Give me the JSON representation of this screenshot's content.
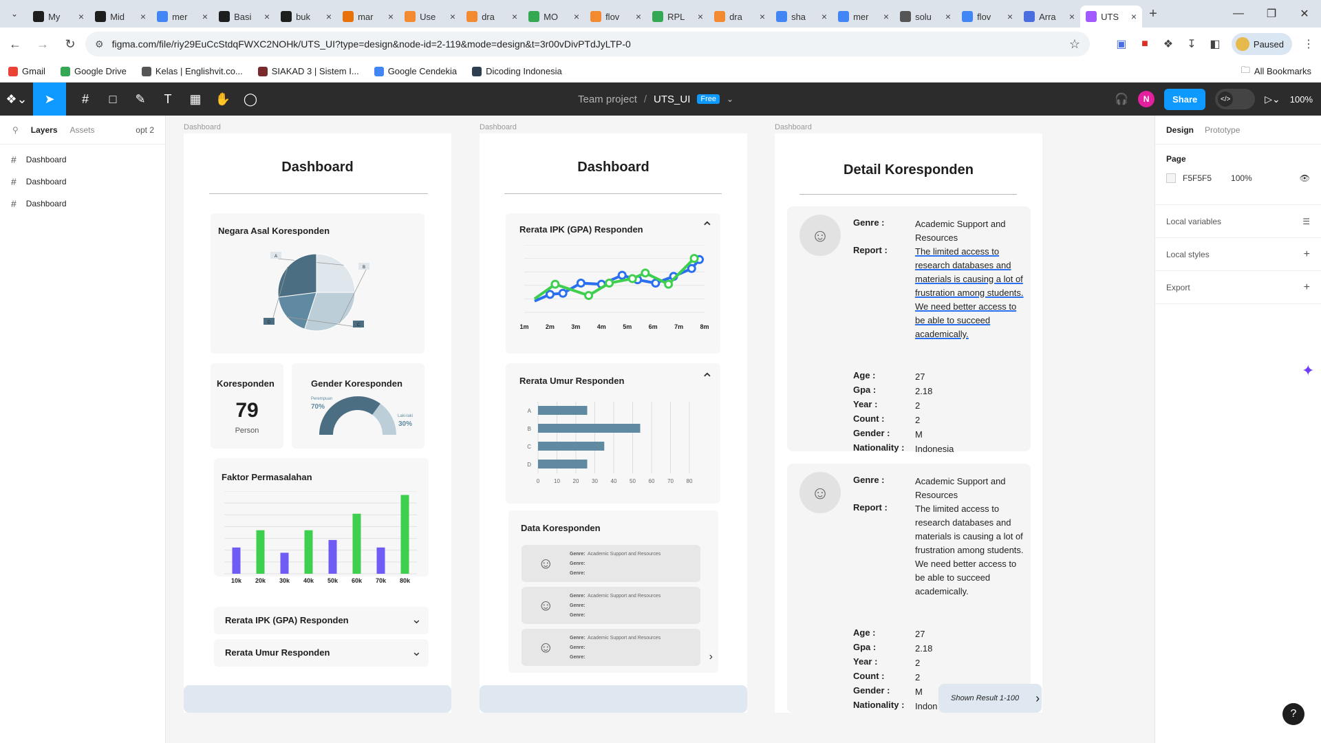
{
  "browser": {
    "tabs": [
      {
        "title": "My",
        "color": "#1e1e1e",
        "icon": "miro-icon"
      },
      {
        "title": "Mid",
        "color": "#1e1e1e",
        "icon": "github-icon"
      },
      {
        "title": "mer",
        "color": "#4285f4",
        "icon": "google-icon"
      },
      {
        "title": "Basi",
        "color": "#1e1e1e",
        "icon": "github-icon"
      },
      {
        "title": "buk",
        "color": "#1e1e1e",
        "icon": "github-icon"
      },
      {
        "title": "mar",
        "color": "#e8710a",
        "icon": "app-icon"
      },
      {
        "title": "Use",
        "color": "#f28b30",
        "icon": "drawio-icon"
      },
      {
        "title": "dra",
        "color": "#f28b30",
        "icon": "drawio-icon"
      },
      {
        "title": "MO",
        "color": "#34a853",
        "icon": "drive-icon"
      },
      {
        "title": "flov",
        "color": "#f28b30",
        "icon": "drawio-icon"
      },
      {
        "title": "RPL",
        "color": "#34a853",
        "icon": "drive-icon"
      },
      {
        "title": "dra",
        "color": "#f28b30",
        "icon": "drawio-icon"
      },
      {
        "title": "sha",
        "color": "#4285f4",
        "icon": "google-icon"
      },
      {
        "title": "mer",
        "color": "#4285f4",
        "icon": "google-icon"
      },
      {
        "title": "solu",
        "color": "#555555",
        "icon": "app-icon"
      },
      {
        "title": "flov",
        "color": "#4285f4",
        "icon": "google-icon"
      },
      {
        "title": "Arra",
        "color": "#4a6ee0",
        "icon": "docs-icon"
      },
      {
        "title": "UTS",
        "color": "#a259ff",
        "icon": "figma-icon"
      }
    ],
    "url": "figma.com/file/riy29EuCcStdqFWXC2NOHk/UTS_UI?type=design&node-id=2-119&mode=design&t=3r00vDivPTdJyLTP-0",
    "profile_label": "Paused",
    "bookmarks": [
      {
        "label": "Gmail",
        "color": "#ea4335"
      },
      {
        "label": "Google Drive",
        "color": "#34a853"
      },
      {
        "label": "Kelas | Englishvit.co...",
        "color": "#555555"
      },
      {
        "label": "SIAKAD 3 | Sistem I...",
        "color": "#7a2a2a"
      },
      {
        "label": "Google Cendekia",
        "color": "#4285f4"
      },
      {
        "label": "Dicoding Indonesia",
        "color": "#2d3e50"
      }
    ],
    "all_bookmarks": "All Bookmarks"
  },
  "figma": {
    "project": "Team project",
    "separator": "/",
    "file": "UTS_UI",
    "plan": "Free",
    "avatar": "N",
    "share": "Share",
    "zoom": "100%",
    "left_tabs": {
      "layers": "Layers",
      "assets": "Assets",
      "page": "opt 2"
    },
    "layers": [
      "Dashboard",
      "Dashboard",
      "Dashboard"
    ],
    "right_tabs": {
      "design": "Design",
      "prototype": "Prototype"
    },
    "page_label": "Page",
    "page_color": "F5F5F5",
    "page_opacity": "100%",
    "sections": [
      "Local variables",
      "Local styles",
      "Export"
    ]
  },
  "canvas": {
    "frame_labels": [
      "Dashboard",
      "Dashboard",
      "Dashboard"
    ],
    "frame1": {
      "title": "Dashboard",
      "pie_title": "Negara Asal Koresponden",
      "pie_labels": [
        "A",
        "B",
        "C",
        "D"
      ],
      "koresponden_title": "Koresponden",
      "koresponden_value": "79",
      "koresponden_unit": "Person",
      "gender_title": "Gender Koresponden",
      "gender_left_label": "Perempuan",
      "gender_left_value": "70%",
      "gender_right_label": "Laki-laki",
      "gender_right_value": "30%",
      "faktor_title": "Faktor Permasalahan",
      "acc1": "Rerata IPK (GPA) Responden",
      "acc2": "Rerata Umur Responden"
    },
    "frame2": {
      "title": "Dashboard",
      "ipk_title": "Rerata IPK (GPA) Responden",
      "umur_title": "Rerata Umur Responden",
      "data_title": "Data Koresponden",
      "mini_rows": [
        {
          "genre_k": "Genre:",
          "genre_v": "Academic Support and Resources",
          "k2": "Genre:",
          "k3": "Genre:"
        },
        {
          "genre_k": "Genre:",
          "genre_v": "Academic Support and Resources",
          "k2": "Genre:",
          "k3": "Genre:"
        },
        {
          "genre_k": "Genre:",
          "genre_v": "Academic Support and Resources",
          "k2": "Genre:",
          "k3": "Genre:"
        }
      ]
    },
    "frame3": {
      "title": "Detail Koresponden",
      "records": [
        {
          "genre_k": "Genre :",
          "genre_v": "Academic Support and Resources",
          "report_k": "Report :",
          "report_v": "The limited access to research databases and materials is causing a lot of frustration among students. We need better access to be able to succeed academically.",
          "age_k": "Age :",
          "age_v": "27",
          "gpa_k": "Gpa :",
          "gpa_v": "2.18",
          "year_k": "Year :",
          "year_v": "2",
          "count_k": "Count :",
          "count_v": "2",
          "gender_k": "Gender :",
          "gender_v": "M",
          "nat_k": "Nationality :",
          "nat_v": "Indonesia"
        },
        {
          "genre_k": "Genre :",
          "genre_v": "Academic Support and Resources",
          "report_k": "Report :",
          "report_v": "The limited access to research databases and materials is causing a lot of frustration among students. We need better access to be able to succeed academically.",
          "age_k": "Age :",
          "age_v": "27",
          "gpa_k": "Gpa :",
          "gpa_v": "2.18",
          "year_k": "Year :",
          "year_v": "2",
          "count_k": "Count :",
          "count_v": "2",
          "gender_k": "Gender :",
          "gender_v": "M",
          "nat_k": "Nationality :",
          "nat_v": "Indon"
        }
      ],
      "shown": "Shown Result 1-100"
    }
  },
  "chart_data": [
    {
      "type": "pie",
      "title": "Negara Asal Koresponden",
      "categories": [
        "A",
        "B",
        "C",
        "D"
      ],
      "values": [
        25,
        30,
        18,
        27
      ],
      "colors": [
        "#dfe6ec",
        "#bccfd9",
        "#5f8aa1",
        "#4c6e82"
      ]
    },
    {
      "type": "bar",
      "title": "Faktor Permasalahan",
      "categories": [
        "10k",
        "20k",
        "30k",
        "40k",
        "50k",
        "60k",
        "70k",
        "80k"
      ],
      "values": [
        35,
        58,
        28,
        58,
        45,
        80,
        35,
        105
      ],
      "colors": [
        "#6f5cf5",
        "#3ecf4f",
        "#6f5cf5",
        "#3ecf4f",
        "#6f5cf5",
        "#3ecf4f",
        "#6f5cf5",
        "#3ecf4f"
      ],
      "ylim": [
        0,
        110
      ]
    },
    {
      "type": "line",
      "title": "Rerata IPK (GPA) Responden",
      "categories": [
        "1m",
        "2m",
        "3m",
        "4m",
        "5m",
        "6m",
        "7m",
        "8m"
      ],
      "series": [
        {
          "color": "#2a6ff0",
          "x": [
            0.4,
            1,
            1.5,
            2.2,
            3,
            3.8,
            4.4,
            5.1,
            5.8,
            6.5,
            6.8
          ],
          "values": [
            1.0,
            1.6,
            1.7,
            2.6,
            2.5,
            3.3,
            2.9,
            2.6,
            3.2,
            3.9,
            4.7
          ]
        },
        {
          "color": "#3ecf4f",
          "x": [
            0.4,
            1.2,
            2.5,
            3.3,
            4.2,
            4.7,
            5.6,
            6.6
          ],
          "values": [
            1.2,
            2.5,
            1.5,
            2.6,
            3.0,
            3.5,
            2.5,
            4.8
          ]
        }
      ],
      "ylim": [
        0,
        6
      ]
    },
    {
      "type": "bar",
      "orientation": "horizontal",
      "title": "Rerata Umur Responden",
      "categories": [
        "A",
        "B",
        "C",
        "D"
      ],
      "values": [
        26,
        54,
        35,
        26
      ],
      "color": "#5f8aa1",
      "xticks": [
        0,
        10,
        20,
        30,
        40,
        50,
        60,
        70,
        80
      ],
      "xlim": [
        0,
        80
      ]
    },
    {
      "type": "gauge",
      "title": "Gender Koresponden",
      "categories": [
        "Perempuan",
        "Laki-laki"
      ],
      "values": [
        70,
        30
      ],
      "colors": [
        "#4c6e82",
        "#bccfd9"
      ]
    }
  ]
}
